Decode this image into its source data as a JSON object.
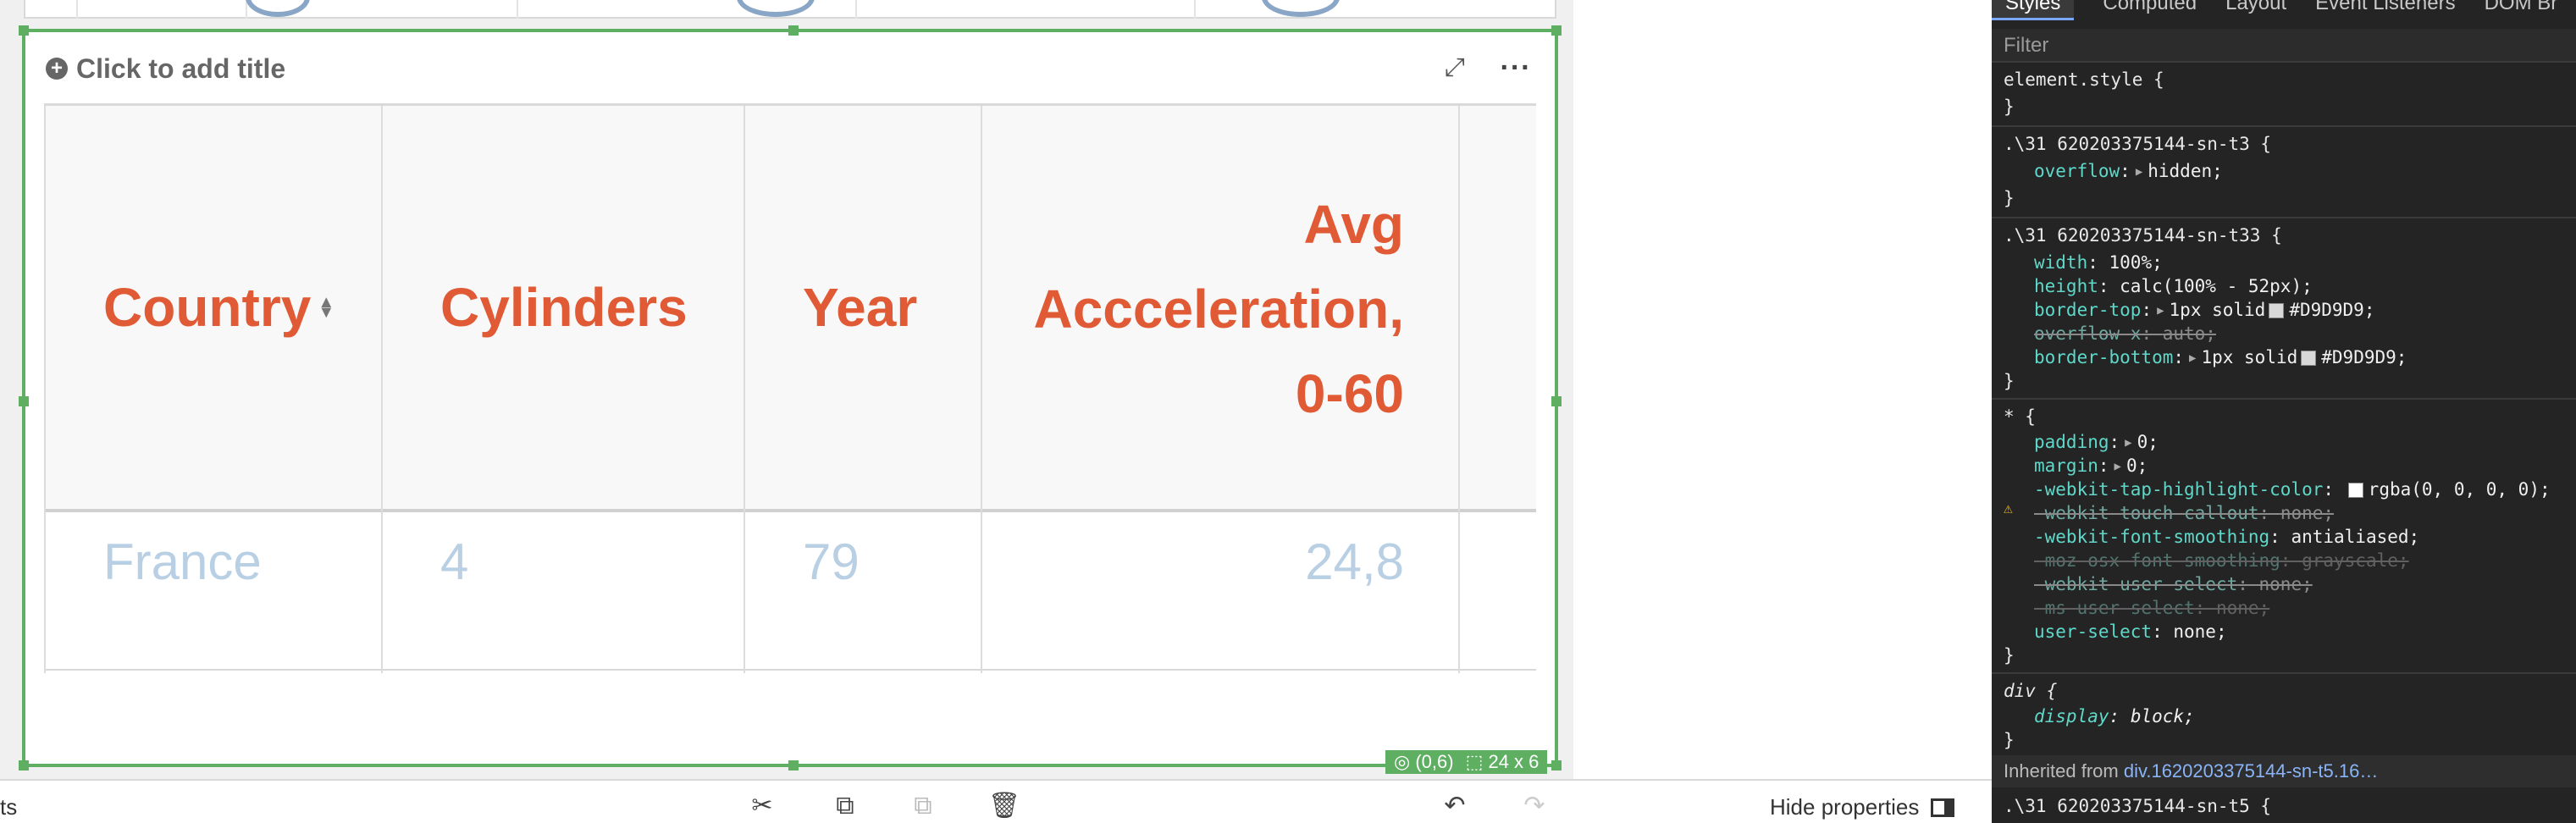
{
  "viz": {
    "title_placeholder": "Click to add title",
    "position_readout": "(0,6)",
    "size_readout": "24 x 6"
  },
  "table": {
    "columns": [
      "Country",
      "Cylinders",
      "Year",
      "Avg Accceleration, 0-60"
    ],
    "header_lines": {
      "country": "Country",
      "cylinders": "Cylinders",
      "year": "Year",
      "avg_line1": "Avg",
      "avg_line2": "Accceleration,",
      "avg_line3": "0-60"
    },
    "rows": [
      {
        "country": "France",
        "cylinders": "4",
        "year": "79",
        "avg": "24,8"
      }
    ]
  },
  "toolbar": {
    "left_label": "ts",
    "hide_properties_label": "Hide properties"
  },
  "devtools": {
    "tabs": [
      "Styles",
      "Computed",
      "Layout",
      "Event Listeners",
      "DOM Br"
    ],
    "filter_placeholder": "Filter",
    "lines": {
      "l1": "element.style {",
      "l2": "}",
      "l3_sel": ".\\31 620203375144-sn-t3 {",
      "l4_prop": "overflow",
      "l4_val": "hidden;",
      "l5": "}",
      "l6_sel": ".\\31 620203375144-sn-t33 {",
      "l7_prop": "width",
      "l7_val": "100%;",
      "l8_prop": "height",
      "l8_val": "calc(100% - 52px);",
      "l9_prop": "border-top",
      "l9_val_a": "1px solid",
      "l9_val_b": "#D9D9D9;",
      "l10_prop": "overflow-x",
      "l10_val": "auto;",
      "l11_prop": "border-bottom",
      "l11_val_a": "1px solid",
      "l11_val_b": "#D9D9D9;",
      "l12": "}",
      "l13_sel": "* {",
      "l14_prop": "padding",
      "l14_val": "0;",
      "l15_prop": "margin",
      "l15_val": "0;",
      "l16_prop": "-webkit-tap-highlight-color",
      "l16_val": "rgba(0, 0, 0, 0);",
      "l17_prop": "-webkit-touch-callout",
      "l17_val": "none;",
      "l18_prop": "-webkit-font-smoothing",
      "l18_val": "antialiased;",
      "l19_prop": "-moz-osx-font-smoothing",
      "l19_val": "grayscale;",
      "l20_prop": "-webkit-user-select",
      "l20_val": "none;",
      "l21_prop": "-ms-user-select",
      "l21_val": "none;",
      "l22_prop": "user-select",
      "l22_val": "none;",
      "l23": "}",
      "l24_sel": "div {",
      "l25_prop": "display",
      "l25_val": "block;",
      "l26": "}",
      "inherited_prefix": "Inherited from",
      "inherited_link": "div.1620203375144-sn-t5.16…",
      "last_sel": ".\\31 620203375144-sn-t5 {"
    }
  },
  "colors": {
    "accent_green": "#5faf63",
    "header_text": "#e05a35",
    "data_text": "#b9cfe4"
  }
}
